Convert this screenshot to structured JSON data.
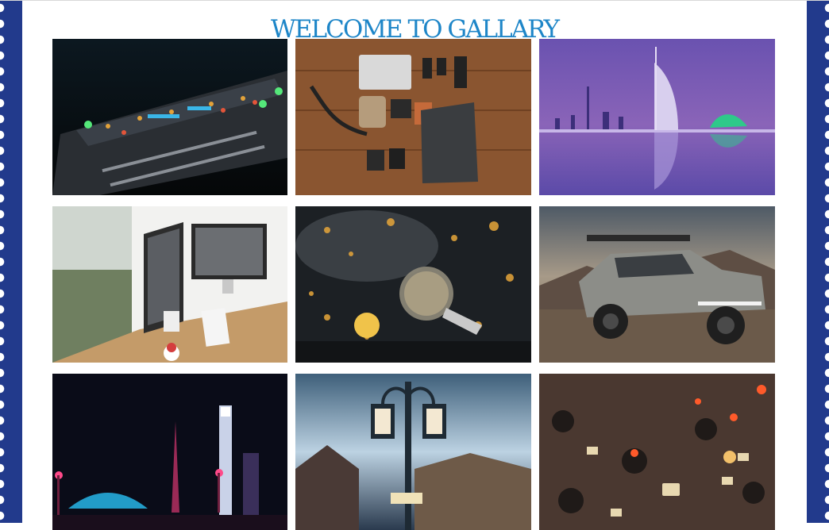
{
  "page": {
    "title": "WELCOME TO GALLARY"
  },
  "gallery": {
    "images": [
      {
        "subject": "audio-mixer-console"
      },
      {
        "subject": "camera-gear-flatlay"
      },
      {
        "subject": "dubai-skyline-night"
      },
      {
        "subject": "desk-computer-monitors"
      },
      {
        "subject": "lightbulb-bokeh"
      },
      {
        "subject": "offroad-truck"
      },
      {
        "subject": "city-lights-night"
      },
      {
        "subject": "street-lamp"
      },
      {
        "subject": "synth-knobs"
      }
    ]
  },
  "colors": {
    "accent": "#1e86c8",
    "border": "#223a8c"
  }
}
